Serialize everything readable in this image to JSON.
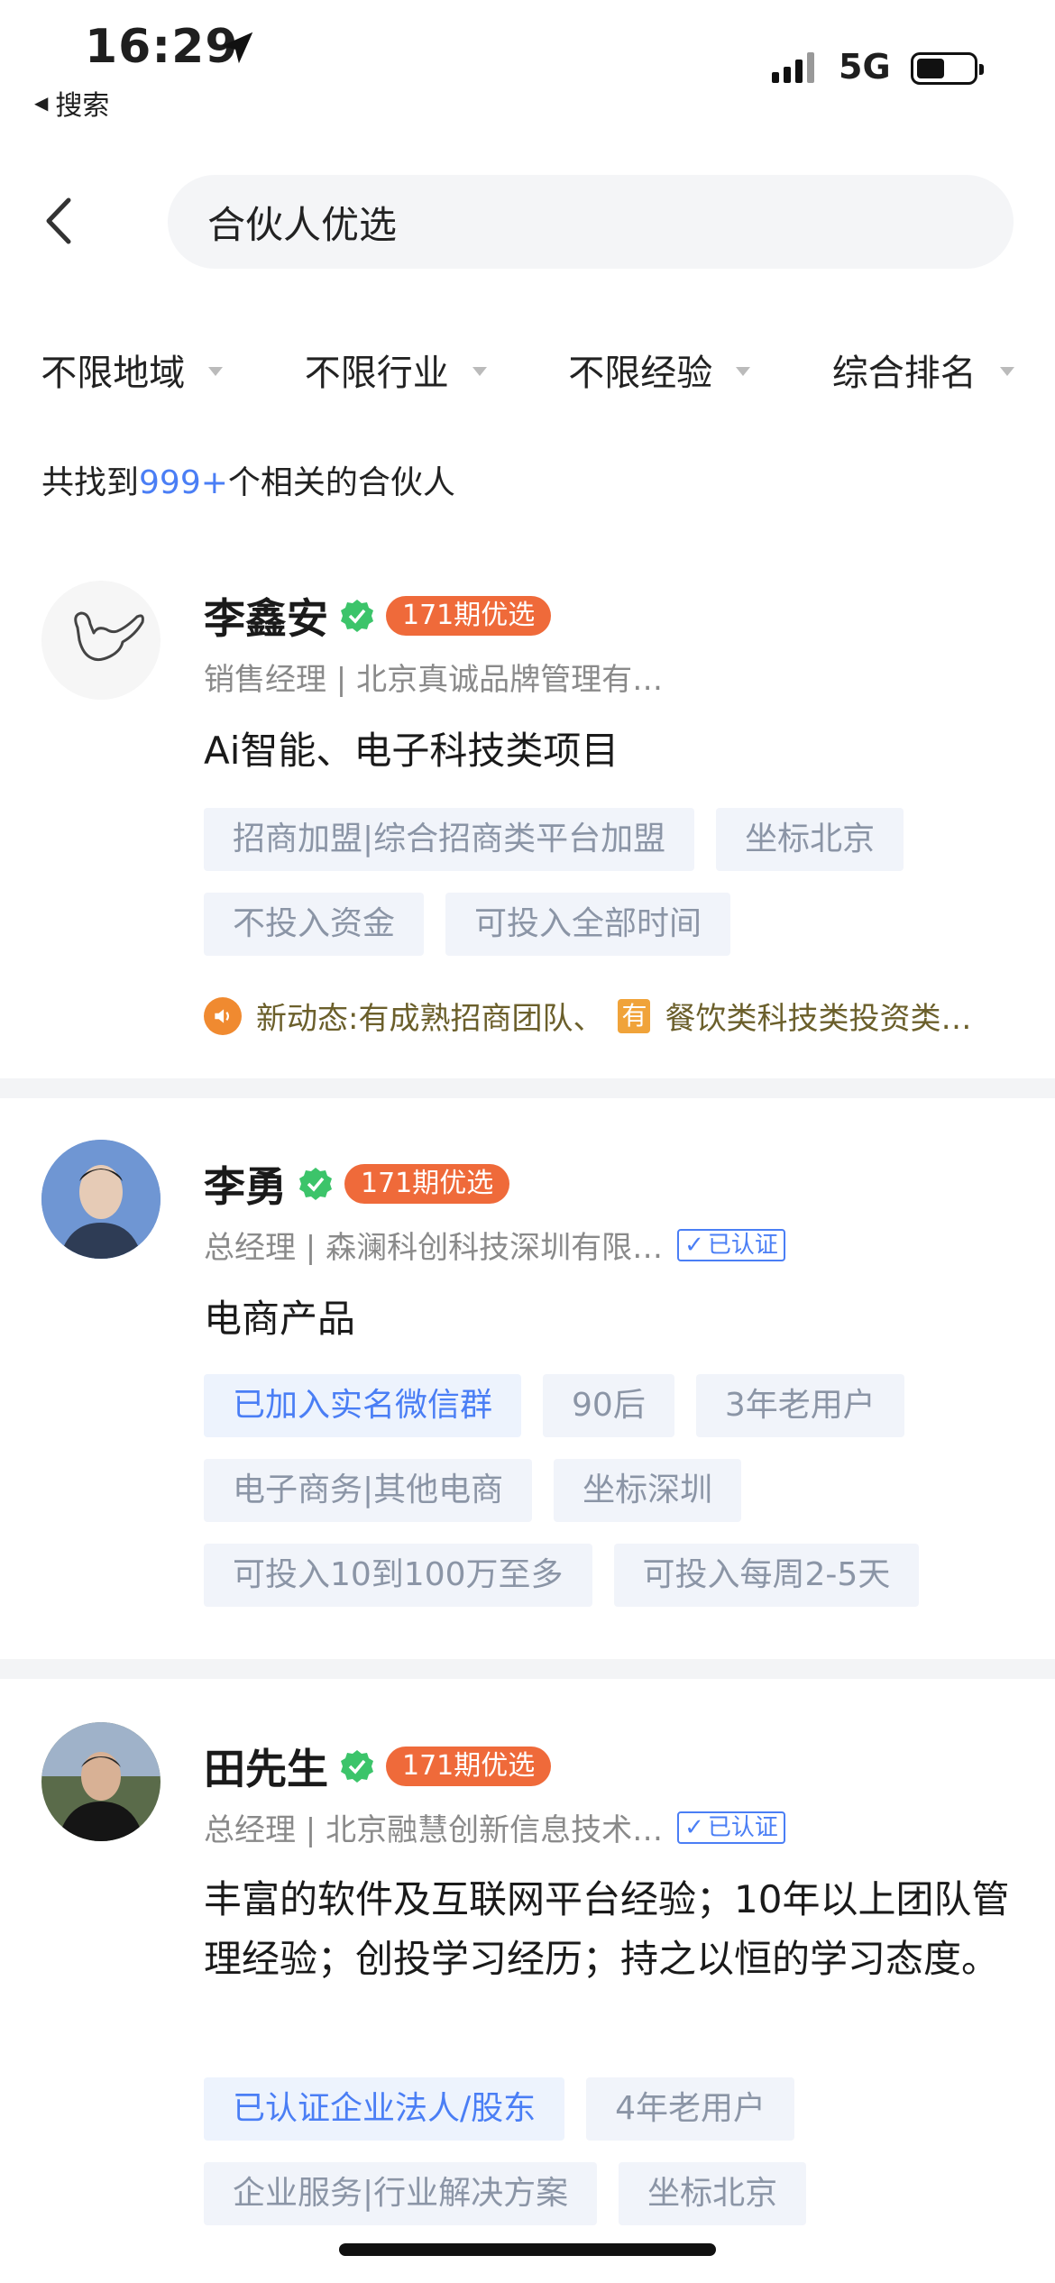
{
  "status_bar": {
    "time": "16:29",
    "back_app": "搜索",
    "network": "5G"
  },
  "search": {
    "query": "合伙人优选"
  },
  "filters": [
    "不限地域",
    "不限行业",
    "不限经验",
    "综合排名"
  ],
  "results": {
    "prefix": "共找到",
    "count": "999+",
    "suffix": "个相关的合伙人"
  },
  "cards": [
    {
      "name": "李鑫安",
      "badge": "171期优选",
      "title": "销售经理 | 北京真诚品牌管理有…",
      "description": "Ai智能、电子科技类项目",
      "tags": [
        {
          "text": "招商加盟|综合招商类平台加盟",
          "blue": false
        },
        {
          "text": "坐标北京",
          "blue": false
        },
        {
          "text": "不投入资金",
          "blue": false
        },
        {
          "text": "可投入全部时间",
          "blue": false
        }
      ],
      "news": {
        "text1": "新动态:有成熟招商团队、",
        "you": "有",
        "text2": "餐饮类科技类投资类…"
      }
    },
    {
      "name": "李勇",
      "badge": "171期优选",
      "title": "总经理 | 森澜科创科技深圳有限…",
      "auth": "已认证",
      "description": "电商产品",
      "tags": [
        {
          "text": "已加入实名微信群",
          "blue": true
        },
        {
          "text": "90后",
          "blue": false
        },
        {
          "text": "3年老用户",
          "blue": false
        },
        {
          "text": "电子商务|其他电商",
          "blue": false
        },
        {
          "text": "坐标深圳",
          "blue": false
        },
        {
          "text": "可投入10到100万至多",
          "blue": false
        },
        {
          "text": "可投入每周2-5天",
          "blue": false
        }
      ]
    },
    {
      "name": "田先生",
      "badge": "171期优选",
      "title": "总经理 | 北京融慧创新信息技术…",
      "auth": "已认证",
      "description": "丰富的软件及互联网平台经验；10年以上团队管理经验；创投学习经历；持之以恒的学习态度。",
      "tags": [
        {
          "text": "已认证企业法人/股东",
          "blue": true
        },
        {
          "text": "4年老用户",
          "blue": false
        },
        {
          "text": "企业服务|行业解决方案",
          "blue": false
        },
        {
          "text": "坐标北京",
          "blue": false
        }
      ]
    }
  ],
  "colors": {
    "accent": "#4a7ef5",
    "badge": "#ef6a3a",
    "verify": "#3cc46a"
  }
}
